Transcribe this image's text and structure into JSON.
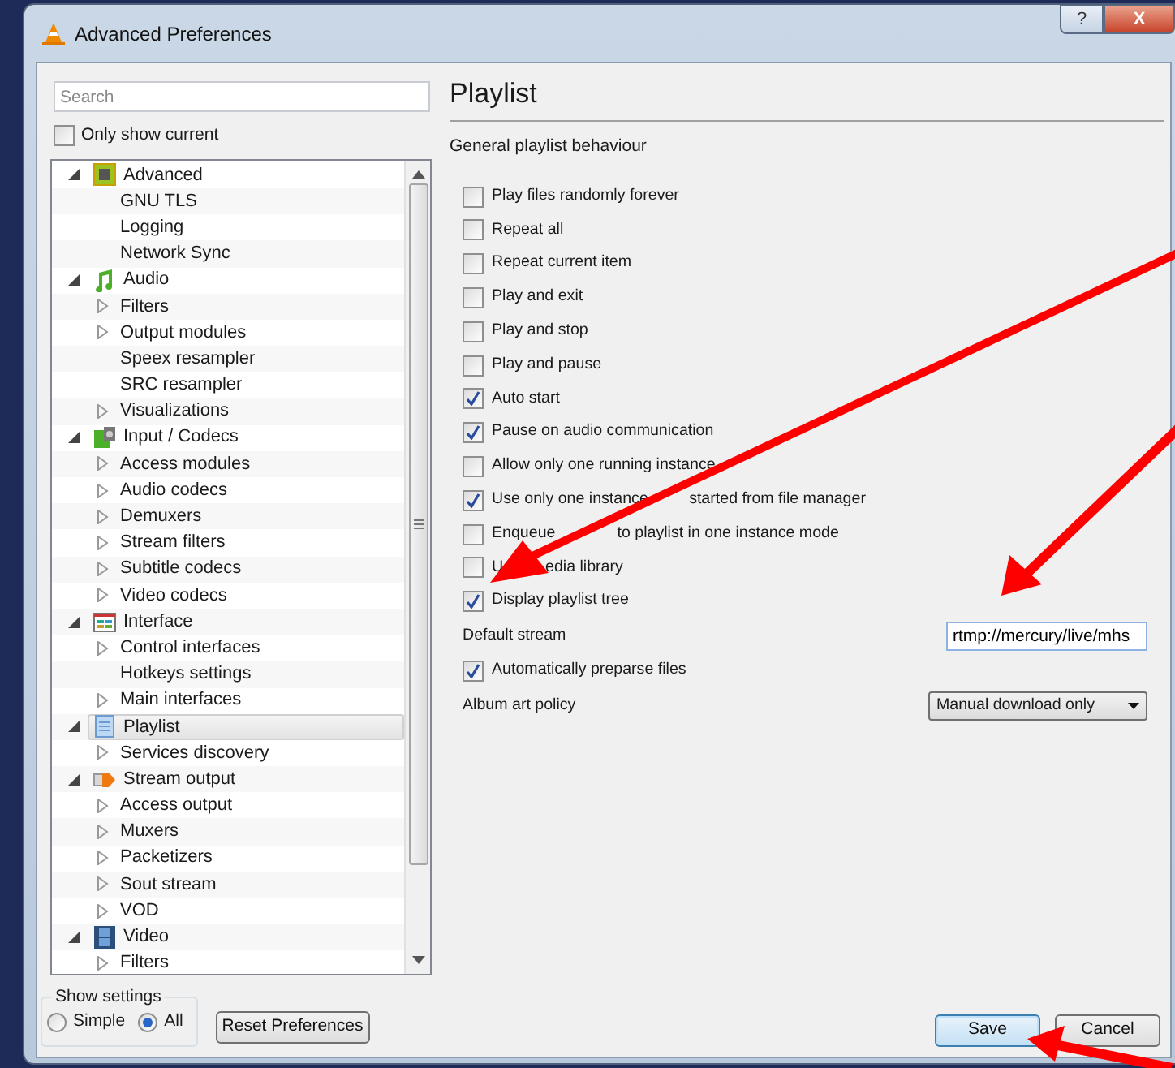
{
  "window": {
    "title": "Advanced Preferences",
    "help": "?",
    "close": "X"
  },
  "search": {
    "placeholder": "Search"
  },
  "only_show_current": {
    "label": "Only show current",
    "checked": false
  },
  "tree": [
    {
      "label": "Advanced",
      "expanded": true,
      "selected": false,
      "children": [
        {
          "label": "GNU TLS",
          "kind": "leaf",
          "selected": false
        },
        {
          "label": "Logging",
          "kind": "leaf",
          "selected": false
        },
        {
          "label": "Network Sync",
          "kind": "leaf",
          "selected": false
        }
      ]
    },
    {
      "label": "Audio",
      "expanded": true,
      "selected": false,
      "children": [
        {
          "label": "Filters",
          "kind": "branch",
          "selected": false
        },
        {
          "label": "Output modules",
          "kind": "branch",
          "selected": false
        },
        {
          "label": "Speex resampler",
          "kind": "leaf",
          "selected": false
        },
        {
          "label": "SRC resampler",
          "kind": "leaf",
          "selected": false
        },
        {
          "label": "Visualizations",
          "kind": "branch",
          "selected": false
        }
      ]
    },
    {
      "label": "Input / Codecs",
      "expanded": true,
      "selected": false,
      "children": [
        {
          "label": "Access modules",
          "kind": "branch",
          "selected": false
        },
        {
          "label": "Audio codecs",
          "kind": "branch",
          "selected": false
        },
        {
          "label": "Demuxers",
          "kind": "branch",
          "selected": false
        },
        {
          "label": "Stream filters",
          "kind": "branch",
          "selected": false
        },
        {
          "label": "Subtitle codecs",
          "kind": "branch",
          "selected": false
        },
        {
          "label": "Video codecs",
          "kind": "branch",
          "selected": false
        }
      ]
    },
    {
      "label": "Interface",
      "expanded": true,
      "selected": false,
      "children": [
        {
          "label": "Control interfaces",
          "kind": "branch",
          "selected": false
        },
        {
          "label": "Hotkeys settings",
          "kind": "leaf",
          "selected": false
        },
        {
          "label": "Main interfaces",
          "kind": "branch",
          "selected": false
        }
      ]
    },
    {
      "label": "Playlist",
      "expanded": true,
      "selected": true,
      "children": [
        {
          "label": "Services discovery",
          "kind": "branch",
          "selected": false
        }
      ]
    },
    {
      "label": "Stream output",
      "expanded": true,
      "selected": false,
      "children": [
        {
          "label": "Access output",
          "kind": "branch",
          "selected": false
        },
        {
          "label": "Muxers",
          "kind": "branch",
          "selected": false
        },
        {
          "label": "Packetizers",
          "kind": "branch",
          "selected": false
        },
        {
          "label": "Sout stream",
          "kind": "branch",
          "selected": false
        },
        {
          "label": "VOD",
          "kind": "branch",
          "selected": false
        }
      ]
    },
    {
      "label": "Video",
      "expanded": true,
      "selected": false,
      "children": [
        {
          "label": "Filters",
          "kind": "branch",
          "selected": false
        }
      ]
    }
  ],
  "show_settings": {
    "title": "Show settings",
    "options": [
      {
        "label": "Simple",
        "selected": false
      },
      {
        "label": "All",
        "selected": true
      }
    ]
  },
  "reset_button": "Reset Preferences",
  "panel": {
    "title": "Playlist",
    "section": "General playlist behaviour",
    "options": [
      {
        "kind": "checkbox",
        "label": "Play files randomly forever",
        "checked": false
      },
      {
        "kind": "checkbox",
        "label": "Repeat all",
        "checked": false
      },
      {
        "kind": "checkbox",
        "label": "Repeat current item",
        "checked": false
      },
      {
        "kind": "checkbox",
        "label": "Play and exit",
        "checked": false
      },
      {
        "kind": "checkbox",
        "label": "Play and stop",
        "checked": false
      },
      {
        "kind": "checkbox",
        "label": "Play and pause",
        "checked": false
      },
      {
        "kind": "checkbox",
        "label": "Auto start",
        "checked": true
      },
      {
        "kind": "checkbox",
        "label": "Pause on audio communication",
        "checked": true
      },
      {
        "kind": "checkbox",
        "label": "Allow only one running instance",
        "checked": false
      },
      {
        "kind": "checkbox",
        "label": [
          "Use only one instance",
          "started from file manager"
        ],
        "checked": true
      },
      {
        "kind": "checkbox",
        "label": [
          "Enqueue",
          "to playlist in one instance mode"
        ],
        "checked": false
      },
      {
        "kind": "checkbox",
        "label": [
          "U",
          "edia library"
        ],
        "checked": false
      },
      {
        "kind": "checkbox",
        "label": "Display playlist tree",
        "checked": true
      },
      {
        "kind": "text",
        "label": "Default stream",
        "value": "rtmp://mercury/live/mhs"
      },
      {
        "kind": "checkbox",
        "label": "Automatically preparse files",
        "checked": true
      },
      {
        "kind": "select",
        "label": "Album art policy",
        "value": "Manual download only"
      }
    ]
  },
  "buttons": [
    {
      "label": "Save",
      "default": true
    },
    {
      "label": "Cancel",
      "default": false
    }
  ]
}
